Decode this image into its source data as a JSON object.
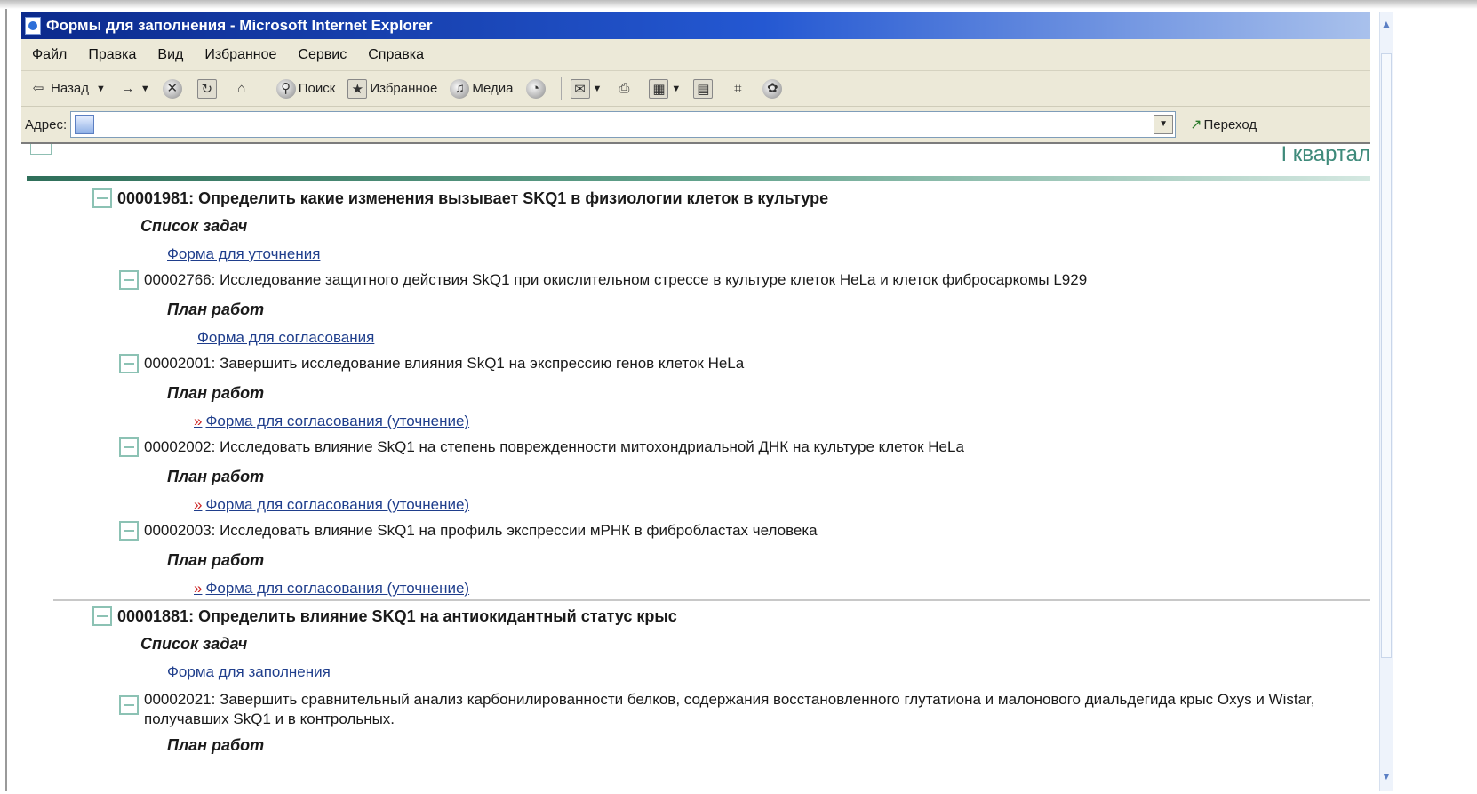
{
  "window": {
    "title": "Формы для заполнения - Microsoft Internet Explorer"
  },
  "menu": [
    "Файл",
    "Правка",
    "Вид",
    "Избранное",
    "Сервис",
    "Справка"
  ],
  "toolbar": {
    "back_label": "Назад",
    "search_label": "Поиск",
    "favorites_label": "Избранное",
    "media_label": "Медиа"
  },
  "address": {
    "label": "Адрес:",
    "value": "",
    "go_label": "Переход"
  },
  "content": {
    "quarter_label": "I квартал",
    "projects": [
      {
        "title": "00001981: Определить какие изменения вызывает SKQ1 в физиологии клеток в культуре",
        "list_label": "Список задач",
        "form_link": "Форма для уточнения",
        "tasks": [
          {
            "title": "00002766: Исследование защитного действия SkQ1 при окислительном стрессе в культуре клеток HeLa и клеток фибросаркомы L929",
            "plan_label": "План работ",
            "link": "Форма для согласования",
            "link_prefix": ""
          },
          {
            "title": "00002001: Завершить исследование влияния SkQ1 на экспрессию генов клеток HeLa",
            "plan_label": "План работ",
            "link": "Форма для согласования (уточнение)",
            "link_prefix": "»"
          },
          {
            "title": "00002002: Исследовать влияние SkQ1 на степень поврежденности митохондриальной ДНК на культуре клеток HeLa",
            "plan_label": "План работ",
            "link": "Форма для согласования (уточнение)",
            "link_prefix": "»"
          },
          {
            "title": "00002003: Исследовать влияние SkQ1 на профиль экспрессии мРНК в фибробластах человека",
            "plan_label": "План работ",
            "link": "Форма для согласования (уточнение)",
            "link_prefix": "»"
          }
        ]
      },
      {
        "title": "00001881: Определить влияние SKQ1 на антиокидантный статус крыс",
        "list_label": "Список задач",
        "form_link": "Форма для заполнения",
        "tasks": [
          {
            "title": "00002021: Завершить сравнительный анализ карбонилированности белков, содержания восстановленного глутатиона и малонового диальдегида крыс Oxys и Wistar, получавших SkQ1 и в контрольных.",
            "plan_label": "План работ"
          }
        ]
      }
    ]
  }
}
